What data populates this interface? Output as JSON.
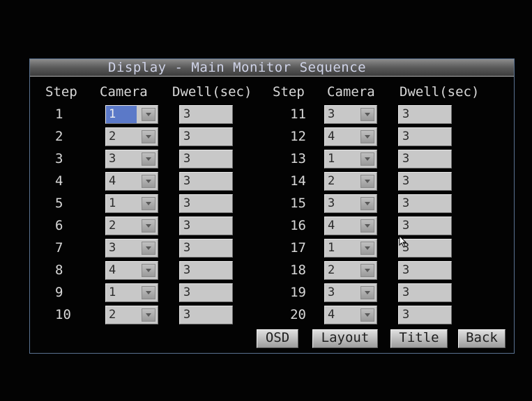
{
  "dialog": {
    "title": "Display - Main Monitor Sequence"
  },
  "headers": {
    "left": {
      "step": "Step",
      "camera": "Camera",
      "dwell": "Dwell(sec)"
    },
    "right": {
      "step": "Step",
      "camera": "Camera",
      "dwell": "Dwell(sec)"
    }
  },
  "steps": [
    {
      "step": "1",
      "camera": "1",
      "dwell": "3"
    },
    {
      "step": "2",
      "camera": "2",
      "dwell": "3"
    },
    {
      "step": "3",
      "camera": "3",
      "dwell": "3"
    },
    {
      "step": "4",
      "camera": "4",
      "dwell": "3"
    },
    {
      "step": "5",
      "camera": "1",
      "dwell": "3"
    },
    {
      "step": "6",
      "camera": "2",
      "dwell": "3"
    },
    {
      "step": "7",
      "camera": "3",
      "dwell": "3"
    },
    {
      "step": "8",
      "camera": "4",
      "dwell": "3"
    },
    {
      "step": "9",
      "camera": "1",
      "dwell": "3"
    },
    {
      "step": "10",
      "camera": "2",
      "dwell": "3"
    },
    {
      "step": "11",
      "camera": "3",
      "dwell": "3"
    },
    {
      "step": "12",
      "camera": "4",
      "dwell": "3"
    },
    {
      "step": "13",
      "camera": "1",
      "dwell": "3"
    },
    {
      "step": "14",
      "camera": "2",
      "dwell": "3"
    },
    {
      "step": "15",
      "camera": "3",
      "dwell": "3"
    },
    {
      "step": "16",
      "camera": "4",
      "dwell": "3"
    },
    {
      "step": "17",
      "camera": "1",
      "dwell": "3"
    },
    {
      "step": "18",
      "camera": "2",
      "dwell": "3"
    },
    {
      "step": "19",
      "camera": "3",
      "dwell": "3"
    },
    {
      "step": "20",
      "camera": "4",
      "dwell": "3"
    }
  ],
  "buttons": {
    "osd": "OSD",
    "layout": "Layout",
    "title": "Title",
    "back": "Back"
  },
  "colors": {
    "selection": "#5b79c8",
    "frame": "#5a7290"
  }
}
